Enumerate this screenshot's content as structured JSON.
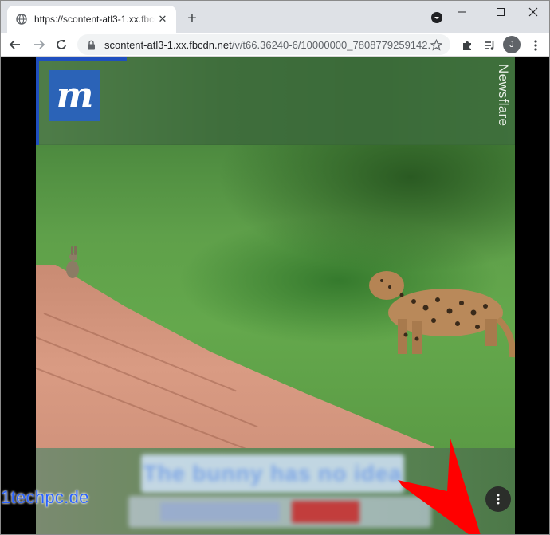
{
  "browser": {
    "tab": {
      "title": "https://scontent-atl3-1.xx.fbcdn.net/v/t66.36240-6/10000000_7808779259142",
      "favicon": "globe-icon",
      "close": "✕"
    },
    "new_tab": "+",
    "window_controls": {
      "minimize": "—",
      "maximize": "☐",
      "close": "✕"
    },
    "omnibox": {
      "host": "scontent-atl3-1.xx.fbcdn.net",
      "path": "/v/t66.36240-6/10000000_7808779259142..."
    },
    "profile_initial": "J"
  },
  "video": {
    "brand_logo_letter": "m",
    "brand_watermark": "Newsflare",
    "caption_line": "The bunny has no idea",
    "menu_icon": "more-vert-icon"
  },
  "watermark": "1techpc.de",
  "colors": {
    "tabstrip": "#dee1e6",
    "accent_blue": "#1f4fbf",
    "arrow_red": "#ff0000"
  }
}
